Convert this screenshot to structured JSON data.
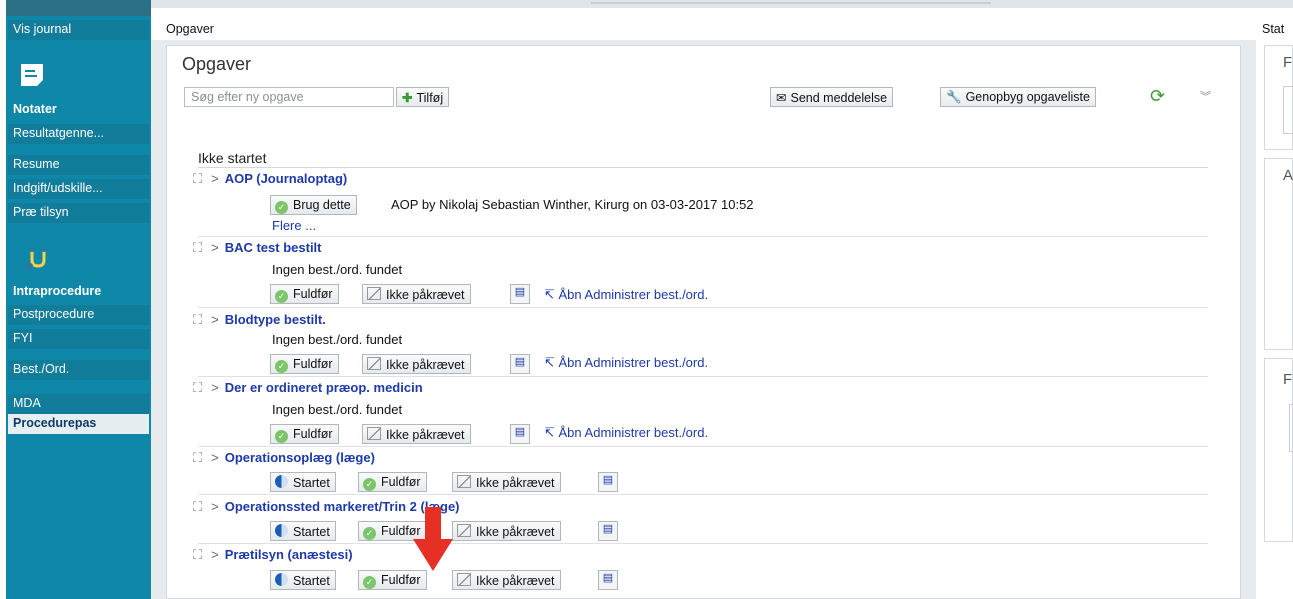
{
  "sidebar": {
    "items": [
      {
        "label": "Vis journal"
      },
      {
        "label": "Notater"
      },
      {
        "label": "Resultatgenne..."
      },
      {
        "label": "Resume"
      },
      {
        "label": "Indgift/udskille..."
      },
      {
        "label": "Præ tilsyn"
      },
      {
        "label": "Intraprocedure"
      },
      {
        "label": "Postprocedure"
      },
      {
        "label": "FYI"
      },
      {
        "label": "Best./Ord."
      },
      {
        "label": "MDA"
      },
      {
        "label": "Procedurepas"
      }
    ],
    "icons": [
      "notes-icon",
      "stethoscope-icon"
    ],
    "accent": "#0f87a8"
  },
  "breadcrumb": {
    "label": "Opgaver",
    "right": "Stat"
  },
  "panel": {
    "title": "Opgaver",
    "search_placeholder": "Søg efter ny opgave",
    "add_label": "Tilføj",
    "send_label": "Send meddelelse",
    "rebuild_label": "Genopbyg opgaveliste"
  },
  "right_panel": {
    "letters": [
      "F",
      "A",
      "F"
    ]
  },
  "group": {
    "label": "Ikke startet"
  },
  "tasks": [
    {
      "title": "AOP (Journaloptag)",
      "use_label": "Brug dette",
      "note": "AOP by Nikolaj Sebastian Winther, Kirurg on 03-03-2017 10:52",
      "more": "Flere ..."
    },
    {
      "title": "BAC test bestilt",
      "note": "Ingen best./ord. fundet",
      "complete": "Fuldfør",
      "not_required": "Ikke påkrævet",
      "open_link": "Åbn Administrer best./ord."
    },
    {
      "title": "Blodtype bestilt.",
      "note": "Ingen best./ord. fundet",
      "complete": "Fuldfør",
      "not_required": "Ikke påkrævet",
      "open_link": "Åbn Administrer best./ord."
    },
    {
      "title": "Der er ordineret præop. medicin",
      "note": "Ingen best./ord. fundet",
      "complete": "Fuldfør",
      "not_required": "Ikke påkrævet",
      "open_link": "Åbn Administrer best./ord."
    },
    {
      "title": "Operationsoplæg (læge)",
      "started": "Startet",
      "complete": "Fuldfør",
      "not_required": "Ikke påkrævet"
    },
    {
      "title": "Operationssted markeret/Trin 2 (læge)",
      "started": "Startet",
      "complete": "Fuldfør",
      "not_required": "Ikke påkrævet"
    },
    {
      "title": "Prætilsyn (anæstesi)",
      "started": "Startet",
      "complete": "Fuldfør",
      "not_required": "Ikke påkrævet"
    }
  ],
  "colors": {
    "link": "#1d3aa8",
    "arrow": "#e53023",
    "check": "#7cc56b"
  }
}
